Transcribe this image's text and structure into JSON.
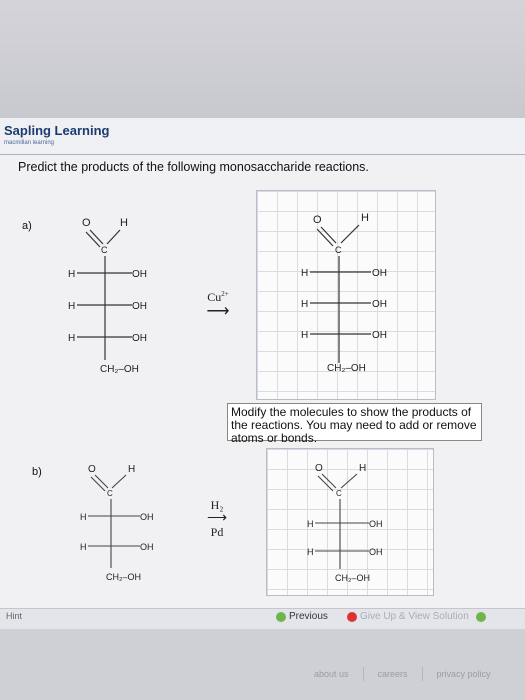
{
  "app": {
    "brand": "Sapling Learning",
    "brand_sub": "macmillan learning"
  },
  "question": {
    "prompt": "Predict the products of the following monosaccharide reactions."
  },
  "part_a": {
    "label": "a)",
    "reagent": "Cu",
    "reagent_charge": "2+",
    "reactant": {
      "carbonyl_O": "O",
      "carbonyl_C": "C",
      "aldehyde_H": "H",
      "rows": [
        {
          "left": "H",
          "right": "OH"
        },
        {
          "left": "H",
          "right": "OH"
        },
        {
          "left": "H",
          "right": "OH"
        }
      ],
      "bottom": "CH₂–OH"
    },
    "editor": {
      "carbonyl_O": "O",
      "carbonyl_C": "C",
      "aldehyde_H": "H",
      "rows": [
        {
          "left": "H",
          "right": "OH"
        },
        {
          "left": "H",
          "right": "OH"
        },
        {
          "left": "H",
          "right": "OH"
        }
      ],
      "bottom": "CH₂–OH"
    }
  },
  "tooltip": {
    "text": "Modify the molecules to show the products of the reactions. You may need to add or remove atoms or bonds."
  },
  "part_b": {
    "label": "b)",
    "reagent_top": "H₂",
    "reagent_bottom": "Pd",
    "reactant": {
      "carbonyl_O": "O",
      "carbonyl_C": "C",
      "aldehyde_H": "H",
      "rows": [
        {
          "left": "H",
          "right": "OH"
        },
        {
          "left": "H",
          "right": "OH"
        }
      ],
      "bottom": "CH₂–OH"
    },
    "editor": {
      "carbonyl_O": "O",
      "carbonyl_C": "C",
      "aldehyde_H": "H",
      "rows": [
        {
          "left": "H",
          "right": "OH"
        },
        {
          "left": "H",
          "right": "OH"
        }
      ],
      "bottom": "CH₂–OH"
    }
  },
  "bottom_bar": {
    "hint": "Hint",
    "previous": "Previous",
    "give_up": "Give Up & View Solution"
  },
  "footer": {
    "about": "about us",
    "careers": "careers",
    "privacy": "privacy policy"
  }
}
